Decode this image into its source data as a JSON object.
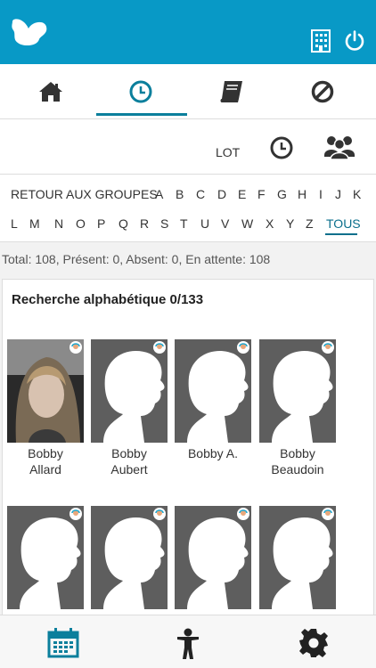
{
  "header": {
    "logo_icon": "butterfly-logo-icon",
    "building_icon": "building-icon",
    "power_icon": "power-icon",
    "accent": "#0899c6"
  },
  "tabs": [
    {
      "icon": "home-icon",
      "active": false
    },
    {
      "icon": "clock-icon",
      "active": true
    },
    {
      "icon": "book-icon",
      "active": false
    },
    {
      "icon": "block-icon",
      "active": false
    }
  ],
  "lot": {
    "label": "LOT",
    "clock_icon": "clock-icon",
    "group_icon": "group-icon"
  },
  "alphabet": {
    "back_label": "RETOUR AUX GROUPES",
    "row1": [
      "A",
      "B",
      "C",
      "D",
      "E",
      "F",
      "G",
      "H",
      "I",
      "J",
      "K"
    ],
    "row2": [
      "L",
      "M",
      "N",
      "O",
      "P",
      "Q",
      "R",
      "S",
      "T",
      "U",
      "V",
      "W",
      "X",
      "Y",
      "Z"
    ],
    "all_label": "TOUS"
  },
  "summary": "Total: 108, Présent: 0, Absent: 0, En attente: 108",
  "list": {
    "title": "Recherche alphabétique 0/133",
    "students": [
      {
        "line1": "Bobby",
        "line2": "Allard",
        "has_photo": true
      },
      {
        "line1": "Bobby",
        "line2": "Aubert",
        "has_photo": false
      },
      {
        "line1": "Bobby A.",
        "line2": "",
        "has_photo": false
      },
      {
        "line1": "Bobby",
        "line2": "Beaudoin",
        "has_photo": false
      },
      {
        "line1": "",
        "line2": "",
        "has_photo": false
      },
      {
        "line1": "",
        "line2": "",
        "has_photo": false
      },
      {
        "line1": "",
        "line2": "",
        "has_photo": false
      },
      {
        "line1": "",
        "line2": "",
        "has_photo": false
      }
    ]
  },
  "bottom_nav": [
    {
      "icon": "calendar-icon"
    },
    {
      "icon": "child-icon"
    },
    {
      "icon": "settings-icon"
    }
  ]
}
